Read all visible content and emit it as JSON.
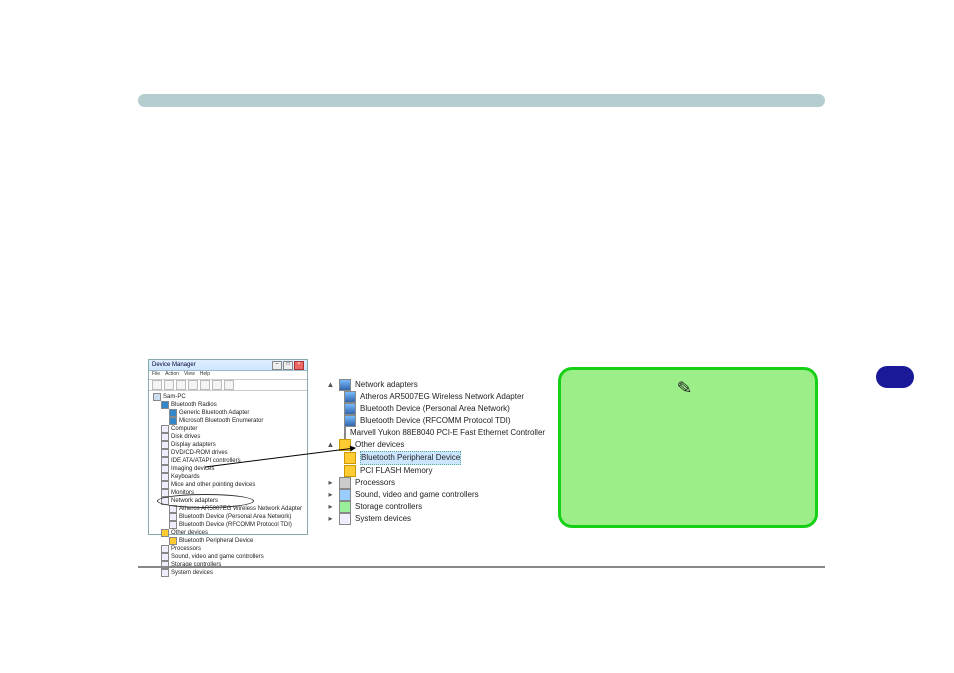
{
  "header": {
    "title": ""
  },
  "side_tab": {
    "label": ""
  },
  "dm1": {
    "window_title": "Device Manager",
    "menu": [
      "File",
      "Action",
      "View",
      "Help"
    ],
    "tree": {
      "root": "Sam-PC",
      "items": [
        "Bluetooth Radios",
        "  Generic Bluetooth Adapter",
        "  Microsoft Bluetooth Enumerator",
        "Computer",
        "Disk drives",
        "Display adapters",
        "DVD/CD-ROM drives",
        "IDE ATA/ATAPI controllers",
        "Imaging devices",
        "Keyboards",
        "Mice and other pointing devices",
        "Monitors",
        "Network adapters",
        "  Atheros AR5007EG Wireless Network Adapter",
        "  Bluetooth Device (Personal Area Network)",
        "  Bluetooth Device (RFCOMM Protocol TDI)",
        "Other devices",
        "  Bluetooth Peripheral Device",
        "Processors",
        "Sound, video and game controllers",
        "Storage controllers",
        "System devices"
      ],
      "highlighted_item": "Bluetooth Peripheral Device"
    }
  },
  "dm2": {
    "rows": [
      {
        "level": 0,
        "expander": "▲",
        "icon": "net",
        "label": "Network adapters"
      },
      {
        "level": 1,
        "expander": "",
        "icon": "net",
        "label": "Atheros AR5007EG Wireless Network Adapter"
      },
      {
        "level": 1,
        "expander": "",
        "icon": "net",
        "label": "Bluetooth Device (Personal Area Network)"
      },
      {
        "level": 1,
        "expander": "",
        "icon": "net",
        "label": "Bluetooth Device (RFCOMM Protocol TDI)"
      },
      {
        "level": 1,
        "expander": "",
        "icon": "net",
        "label": "Marvell Yukon 88E8040 PCI-E Fast Ethernet Controller"
      },
      {
        "level": 0,
        "expander": "▲",
        "icon": "warn",
        "label": "Other devices"
      },
      {
        "level": 1,
        "expander": "",
        "icon": "warn",
        "label": "Bluetooth Peripheral Device",
        "selected": true
      },
      {
        "level": 1,
        "expander": "",
        "icon": "warn",
        "label": "PCI FLASH Memory"
      },
      {
        "level": 0,
        "expander": "▸",
        "icon": "cpu",
        "label": "Processors"
      },
      {
        "level": 0,
        "expander": "▸",
        "icon": "snd",
        "label": "Sound, video and game controllers"
      },
      {
        "level": 0,
        "expander": "▸",
        "icon": "stor",
        "label": "Storage controllers"
      },
      {
        "level": 0,
        "expander": "▸",
        "icon": "",
        "label": "System devices"
      }
    ]
  },
  "callout": {
    "icon_name": "pen-icon",
    "text": ""
  }
}
